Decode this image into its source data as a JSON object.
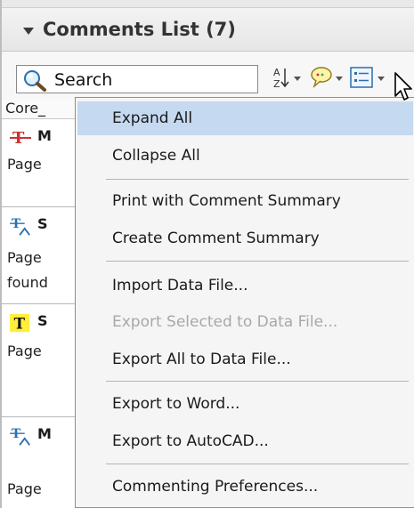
{
  "panel": {
    "title": "Comments List (7)"
  },
  "toolbar": {
    "search_placeholder": "Search",
    "sort_icon": "sort-az-icon",
    "filter_icon": "filter-comments-icon",
    "options_icon": "options-menu-icon"
  },
  "filter_label": "Core_",
  "comments": [
    {
      "icon": "strikethrough-icon",
      "letter": "M",
      "lines": [
        "Page"
      ]
    },
    {
      "icon": "replace-text-icon",
      "letter": "S",
      "lines": [
        "Page",
        "found"
      ]
    },
    {
      "icon": "text-highlight-icon",
      "letter": "S",
      "lines": [
        "Page"
      ]
    },
    {
      "icon": "replace-text-icon",
      "letter": "M",
      "lines": [
        "Page"
      ]
    }
  ],
  "menu": {
    "items": [
      {
        "label": "Expand All",
        "enabled": true,
        "highlighted": true
      },
      {
        "label": "Collapse All",
        "enabled": true,
        "highlighted": false
      },
      {
        "label": "Print with Comment Summary",
        "enabled": true,
        "highlighted": false
      },
      {
        "label": "Create Comment Summary",
        "enabled": true,
        "highlighted": false
      },
      {
        "label": "Import Data File...",
        "enabled": true,
        "highlighted": false
      },
      {
        "label": "Export Selected to Data File...",
        "enabled": false,
        "highlighted": false
      },
      {
        "label": "Export All to Data File...",
        "enabled": true,
        "highlighted": false
      },
      {
        "label": "Export to Word...",
        "enabled": true,
        "highlighted": false
      },
      {
        "label": "Export to AutoCAD...",
        "enabled": true,
        "highlighted": false
      },
      {
        "label": "Commenting Preferences...",
        "enabled": true,
        "highlighted": false
      }
    ]
  },
  "colors": {
    "highlight": "#c5d9f0",
    "disabled_text": "#a8a8a8",
    "strike_red": "#d03030",
    "text_highlight_yellow": "#ffef3a"
  }
}
